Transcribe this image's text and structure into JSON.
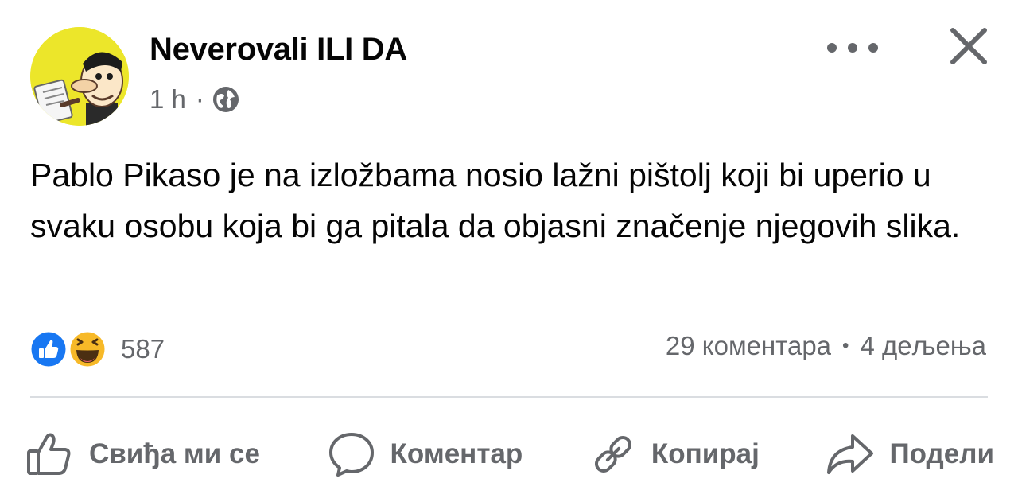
{
  "post": {
    "author": "Neverovali ILI DA",
    "time": "1 h",
    "separator": "·",
    "audience_icon": "globe-icon",
    "text": "Pablo Pikaso je na izložbama nosio lažni pištolj koji bi uperio u svaku osobu koja bi ga pitala da objasni značenje njegovih slika."
  },
  "header": {
    "more_icon": "more-options-icon",
    "close_icon": "close-icon"
  },
  "reactions": {
    "icons": [
      "like-reaction-icon",
      "haha-reaction-icon"
    ],
    "count": "587"
  },
  "stats": {
    "comments": "29 коментара",
    "separator": "•",
    "shares": "4 дељења"
  },
  "actions": {
    "like": "Свиђа ми се",
    "comment": "Коментар",
    "copy": "Копирај",
    "share": "Подели"
  },
  "colors": {
    "text": "#050505",
    "secondary": "#65676b",
    "like_blue": "#1877f2",
    "haha_yellow": "#f7b928",
    "divider": "#dadde1"
  }
}
